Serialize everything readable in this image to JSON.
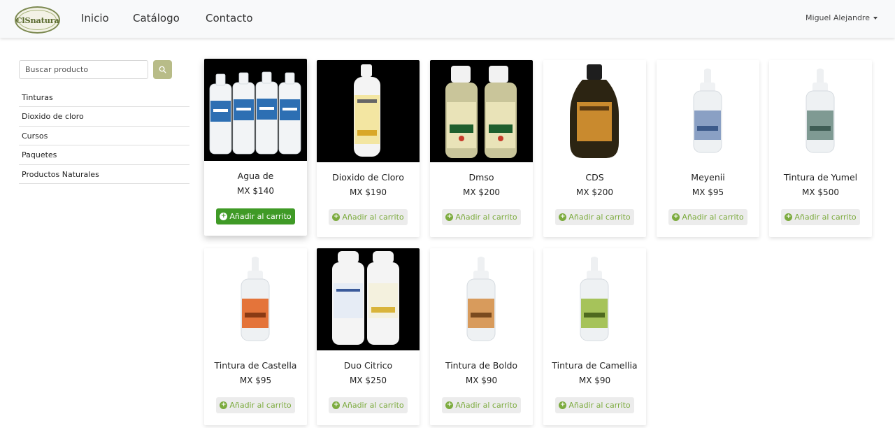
{
  "navbar": {
    "logo_text": "ClSnatura",
    "links": [
      "Inicio",
      "Catálogo",
      "Contacto"
    ],
    "user_name": "Miguel Alejandre"
  },
  "sidebar": {
    "search_placeholder": "Buscar producto",
    "categories": [
      "Tinturas",
      "Dioxido de cloro",
      "Cursos",
      "Paquetes",
      "Productos Naturales"
    ]
  },
  "products": [
    {
      "name": "Agua de",
      "price": "MX $140",
      "button": "Añadir al carrito"
    },
    {
      "name": "Dioxido de Cloro",
      "price": "MX $190",
      "button": "Añadir al carrito"
    },
    {
      "name": "Dmso",
      "price": "MX $200",
      "button": "Añadir al carrito"
    },
    {
      "name": "CDS",
      "price": "MX $200",
      "button": "Añadir al carrito"
    },
    {
      "name": "Meyenii",
      "price": "MX $95",
      "button": "Añadir al carrito"
    },
    {
      "name": "Tintura de Yumel",
      "price": "MX $500",
      "button": "Añadir al carrito"
    },
    {
      "name": "Tintura de Castella",
      "price": "MX $95",
      "button": "Añadir al carrito"
    },
    {
      "name": "Duo Citrico",
      "price": "MX $250",
      "button": "Añadir al carrito"
    },
    {
      "name": "Tintura de Boldo",
      "price": "MX $90",
      "button": "Añadir al carrito"
    },
    {
      "name": "Tintura de Camellia",
      "price": "MX $90",
      "button": "Añadir al carrito"
    }
  ],
  "colors": {
    "accent_green": "#3f9a26",
    "light_green_text": "#7cab3e",
    "search_button": "#b8bc88"
  }
}
